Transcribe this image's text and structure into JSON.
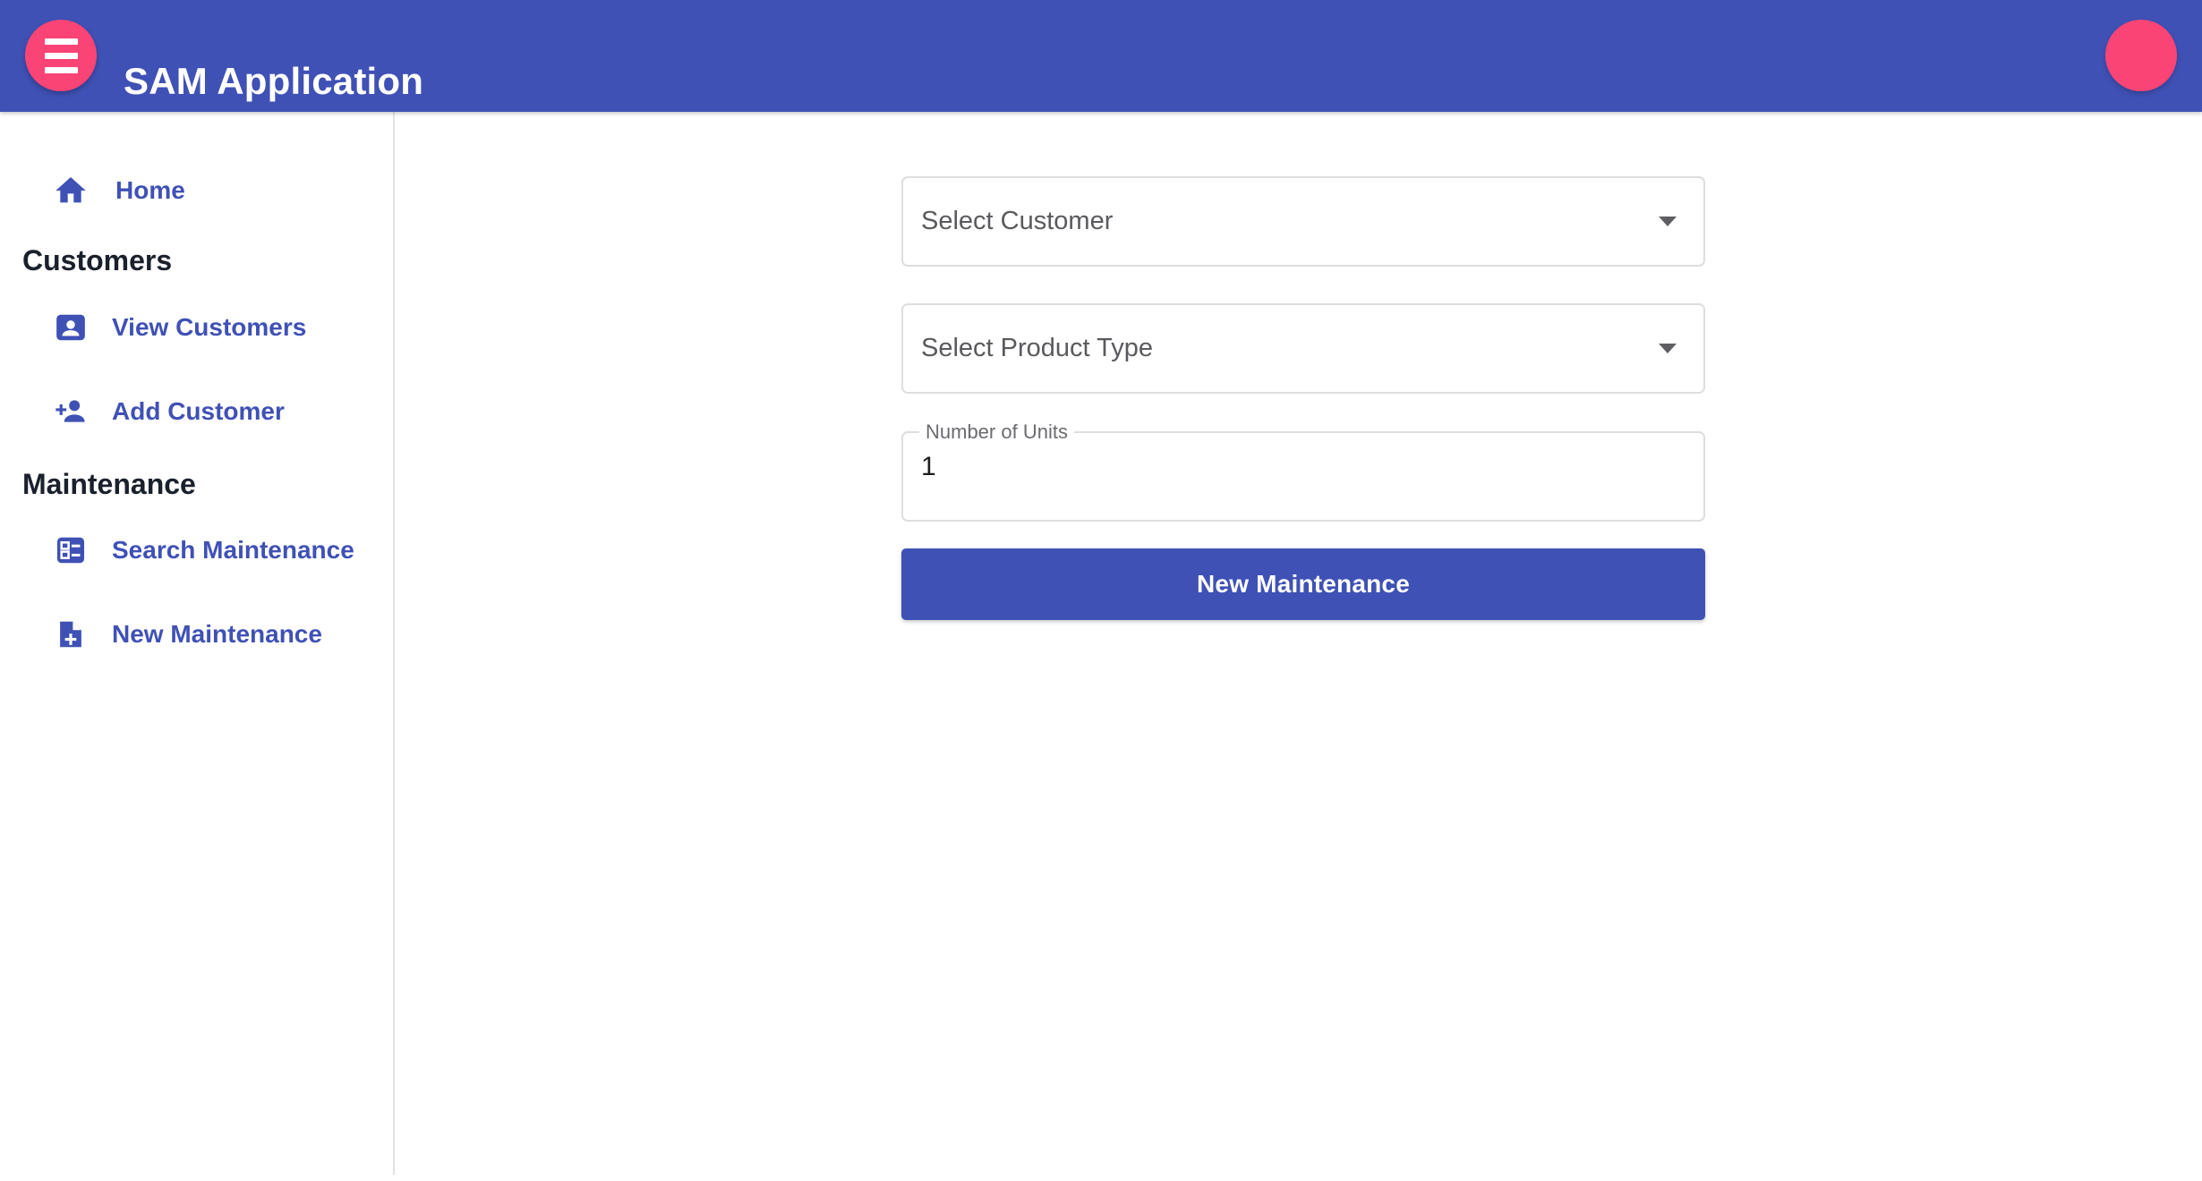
{
  "theme": {
    "primary": "#3f51b5",
    "accent_pink": "#fb4476",
    "nav_link": "#3f51b5",
    "section_heading": "#1a202c",
    "placeholder": "#5a5a5e",
    "field_border": "#dededf"
  },
  "appbar": {
    "title": "SAM Application",
    "menu_icon": "hamburger-menu-icon",
    "avatar_icon": "account-avatar-icon"
  },
  "sidebar": {
    "home": {
      "label": "Home",
      "icon": "home-icon"
    },
    "sections": [
      {
        "title": "Customers",
        "items": [
          {
            "label": "View Customers",
            "icon": "contact-card-icon"
          },
          {
            "label": "Add Customer",
            "icon": "person-add-icon"
          }
        ]
      },
      {
        "title": "Maintenance",
        "items": [
          {
            "label": "Search Maintenance",
            "icon": "ballot-list-icon"
          },
          {
            "label": "New Maintenance",
            "icon": "note-add-icon"
          }
        ]
      }
    ]
  },
  "form": {
    "customer_select": {
      "value": "Select Customer",
      "placeholder": "Select Customer",
      "caret_icon": "chevron-down-icon"
    },
    "product_type_select": {
      "value": "Select Product Type",
      "placeholder": "Select Product Type",
      "caret_icon": "chevron-down-icon"
    },
    "units_field": {
      "label": "Number of Units",
      "value": "1",
      "placeholder": "Number of Units"
    },
    "submit_label": "New Maintenance"
  }
}
